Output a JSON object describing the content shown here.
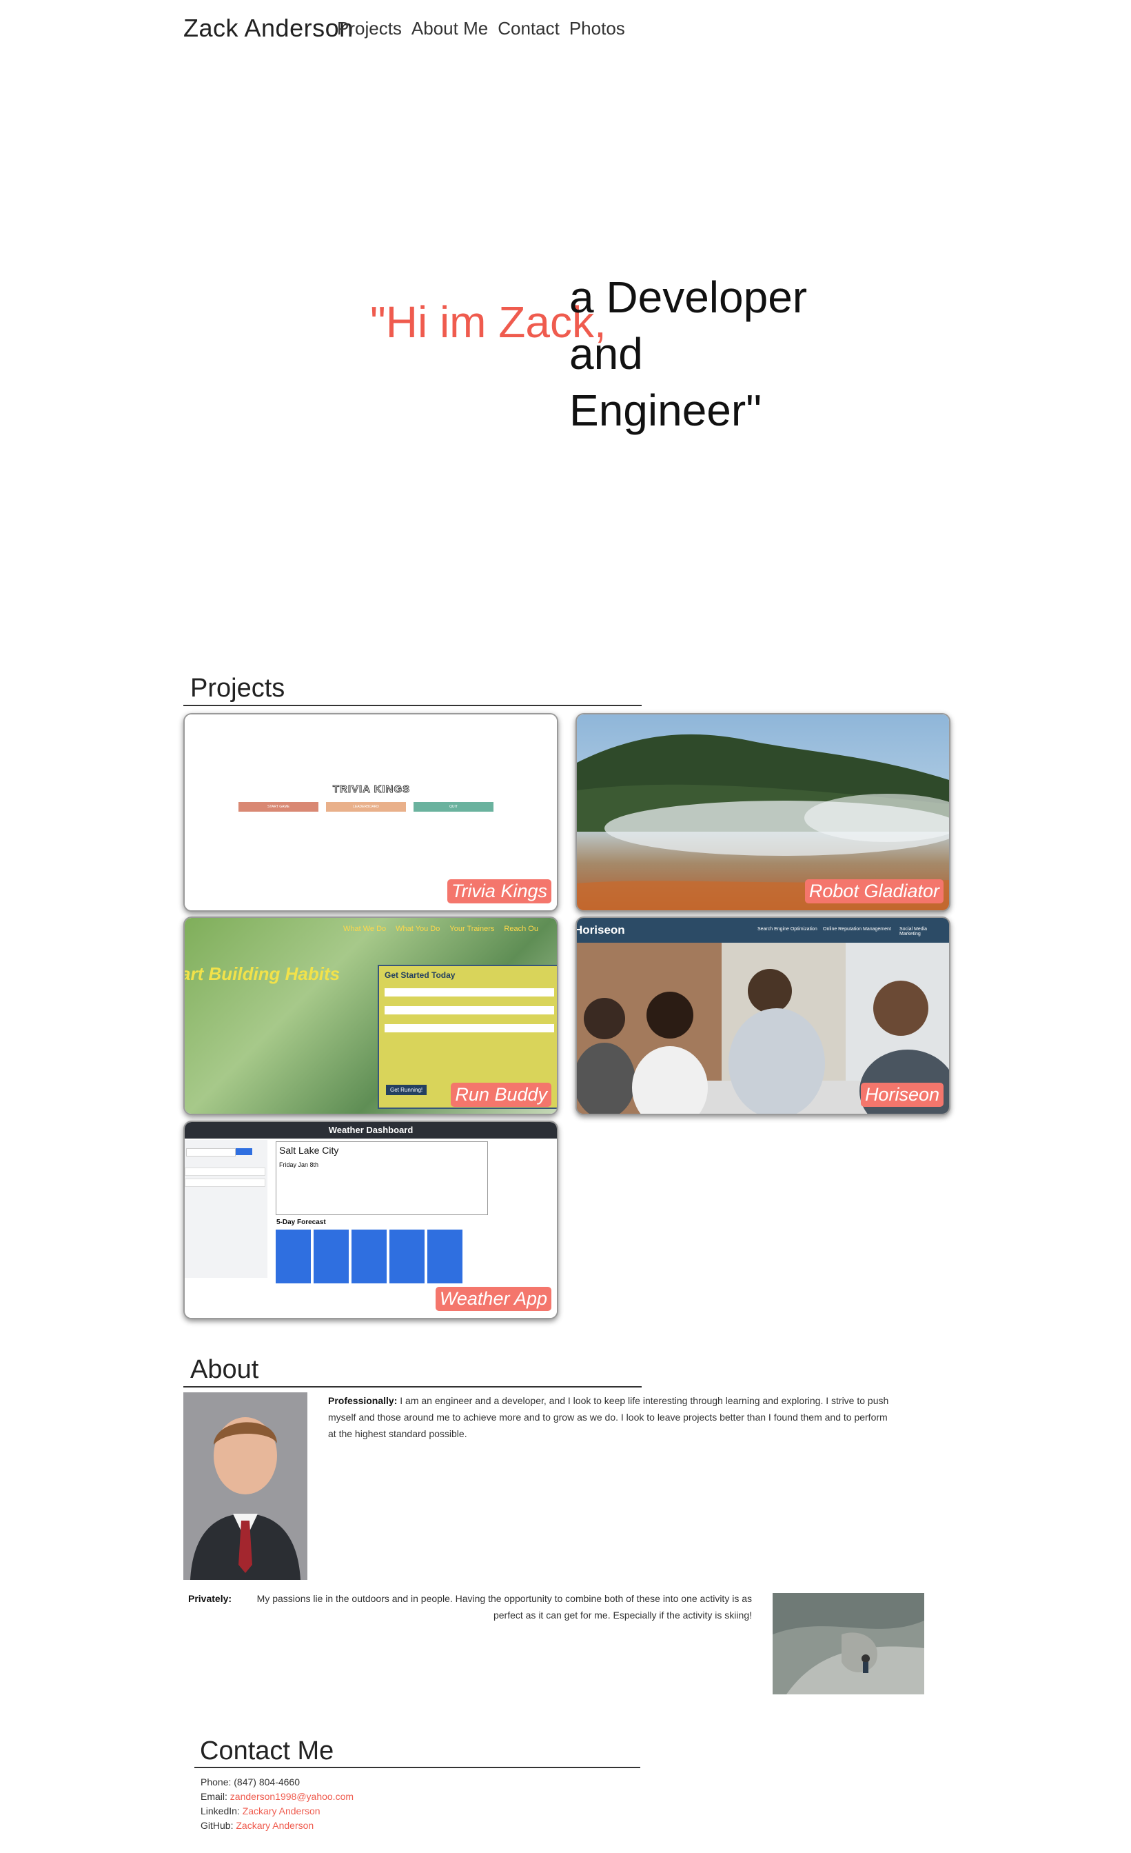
{
  "header": {
    "brand": "Zack Anderson",
    "nav": [
      "Projects",
      "About Me",
      "Contact",
      "Photos"
    ]
  },
  "hero": {
    "greeting": "\"Hi im Zack,",
    "line1": "a Developer and",
    "line2": "Engineer\""
  },
  "projects": {
    "title": "Projects",
    "cards": [
      {
        "label": "Trivia Kings",
        "screenshot_title": "TRIVIA KINGS",
        "screenshot_buttons": [
          "START GAME",
          "LEADERBOARD",
          "QUIT"
        ]
      },
      {
        "label": "Robot Gladiator"
      },
      {
        "label": "Run Buddy",
        "screenshot_heading": "art Building Habits",
        "screenshot_nav": [
          "What We Do",
          "What You Do",
          "Your Trainers",
          "Reach Ou"
        ],
        "form_title": "Get Started Today",
        "form_button": "Get Running!"
      },
      {
        "label": "Horiseon",
        "screenshot_brand": "Horiseon",
        "screenshot_nav": [
          "Search Engine Optimization",
          "Online Reputation Management",
          "Social Media Marketing"
        ]
      },
      {
        "label": "Weather App",
        "screenshot_title": "Weather Dashboard",
        "screenshot_city": "Salt Lake City",
        "screenshot_date": "Friday Jan 8th",
        "screenshot_forecast": "5-Day Forecast"
      }
    ]
  },
  "about": {
    "title": "About",
    "professional_label": "Professionally:",
    "professional_text": " I am an engineer and a developer, and I look to keep life interesting through learning and exploring. I strive to push myself and those around me to achieve more and to grow as we do. I look to leave projects better than I found them and to perform at the highest standard possible.",
    "private_label": "Privately:",
    "private_text": " My passions lie in the outdoors and in people. Having the opportunity to combine both of these into one activity is as perfect as it can get for me. Especially if the activity is skiing!"
  },
  "contact": {
    "title": "Contact Me",
    "phone_label": "Phone: ",
    "phone": "(847) 804-4660",
    "email_label": "Email: ",
    "email": "zanderson1998@yahoo.com",
    "linkedin_label": "LinkedIn: ",
    "linkedin": "Zackary Anderson",
    "github_label": "GitHub: ",
    "github": "Zackary Anderson"
  },
  "colors": {
    "accent": "#ef5b4e",
    "tag_bg": "#f4766c"
  }
}
